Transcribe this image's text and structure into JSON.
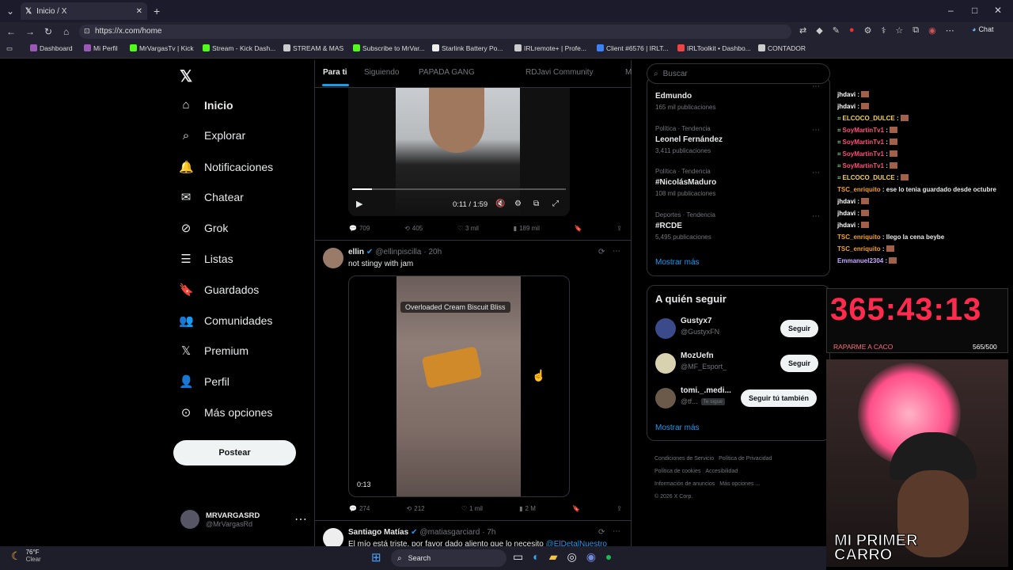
{
  "browser": {
    "tab_title": "Inicio / X",
    "new_tab": "+",
    "url": "https://x.com/home",
    "chat_label": "Chat",
    "bookmarks": [
      "Dashboard",
      "Mi Perfil",
      "MrVargasTv | Kick",
      "Stream - Kick Dash...",
      "STREAM & MAS",
      "Subscribe to MrVar...",
      "Starlink Battery Po...",
      "IRLremote+ | Profe...",
      "Client #6576 | IRLT...",
      "IRLToolkit • Dashbo...",
      "CONTADOR"
    ]
  },
  "nav": {
    "items": [
      "Inicio",
      "Explorar",
      "Notificaciones",
      "Chatear",
      "Grok",
      "Listas",
      "Guardados",
      "Comunidades",
      "Premium",
      "Perfil",
      "Más opciones"
    ],
    "post_button": "Postear",
    "account_name": "MRVARGASRD",
    "account_handle": "@MrVargasRd"
  },
  "feed": {
    "tabs": [
      "Para ti",
      "Siguiendo",
      "PAPADA GANG",
      "RDJavi Community",
      "M"
    ],
    "tweet1": {
      "video_time": "0:11 / 1:59",
      "replies": "709",
      "retweets": "405",
      "likes": "3 mil",
      "views": "189 mil"
    },
    "tweet2": {
      "name": "ellin",
      "handle": "@ellinpiscilla",
      "time": "· 20h",
      "text": "not stingy with jam",
      "video_caption": "Overloaded Cream Biscuit Bliss",
      "video_time": "0:13",
      "replies": "274",
      "retweets": "212",
      "likes": "1 mil",
      "views": "2 M"
    },
    "tweet3": {
      "name": "Santiago Matías",
      "handle": "@matiasgarciard",
      "time": "· 7h",
      "text": "El mío está triste, por favor dado aliento que lo necesito",
      "mention": "@ElDetalNuestro"
    }
  },
  "sidebar": {
    "search_placeholder": "Buscar",
    "trends": [
      {
        "cat": "Política · Tendencia",
        "name": "Edmundo",
        "count": "165 mil publicaciones"
      },
      {
        "cat": "Política · Tendencia",
        "name": "Leonel Fernández",
        "count": "3,411 publicaciones"
      },
      {
        "cat": "Política · Tendencia",
        "name": "#NicolásMaduro",
        "count": "108 mil publicaciones"
      },
      {
        "cat": "Deportes · Tendencia",
        "name": "#RCDE",
        "count": "5,495 publicaciones"
      }
    ],
    "show_more": "Mostrar más",
    "who_to_follow": "A quién seguir",
    "follow": [
      {
        "name": "Gustyx7",
        "handle": "@GustyxFN",
        "btn": "Seguir"
      },
      {
        "name": "MozUefn",
        "handle": "@MF_Esport_",
        "btn": "Seguir"
      },
      {
        "name": "tomi._.medi...",
        "handle": "@tf...",
        "badge": "Te sigue",
        "btn": "Seguir tú también"
      }
    ],
    "show_more2": "Mostrar más",
    "footer": [
      "Condiciones de Servicio",
      "Política de Privacidad",
      "Política de cookies",
      "Accesibilidad",
      "Información de anuncios",
      "Más opciones ...",
      "© 2026 X Corp."
    ]
  },
  "overlay": {
    "chat": [
      {
        "user": "jhdavi",
        "msg": ""
      },
      {
        "user": "jhdavi",
        "msg": ""
      },
      {
        "user": "ELCOCO_DULCE",
        "msg": ""
      },
      {
        "user": "SoyMartinTv1",
        "msg": ""
      },
      {
        "user": "SoyMartinTv1",
        "msg": ""
      },
      {
        "user": "SoyMartinTv1",
        "msg": ""
      },
      {
        "user": "SoyMartinTv1",
        "msg": ""
      },
      {
        "user": "ELCOCO_DULCE",
        "msg": ""
      },
      {
        "user": "TSC_enriquito",
        "msg": "ese lo tenia guardado desde octubre"
      },
      {
        "user": "jhdavi",
        "msg": ""
      },
      {
        "user": "jhdavi",
        "msg": ""
      },
      {
        "user": "jhdavi",
        "msg": ""
      },
      {
        "user": "TSC_enriquito",
        "msg": "llego la cena beybe"
      },
      {
        "user": "TSC_enriquito",
        "msg": ""
      },
      {
        "user": "Emmanuel2304",
        "msg": ""
      }
    ],
    "timer": "365:43:13",
    "goal_label": "RAPARME A CACO",
    "goal_count": "565/500",
    "banner": "MI PRIMER CARRO"
  },
  "taskbar": {
    "temp": "76°F",
    "weather": "Clear",
    "search": "Search"
  },
  "colors": {
    "accent": "#1d9bf0",
    "timer": "#ff2a4d"
  }
}
